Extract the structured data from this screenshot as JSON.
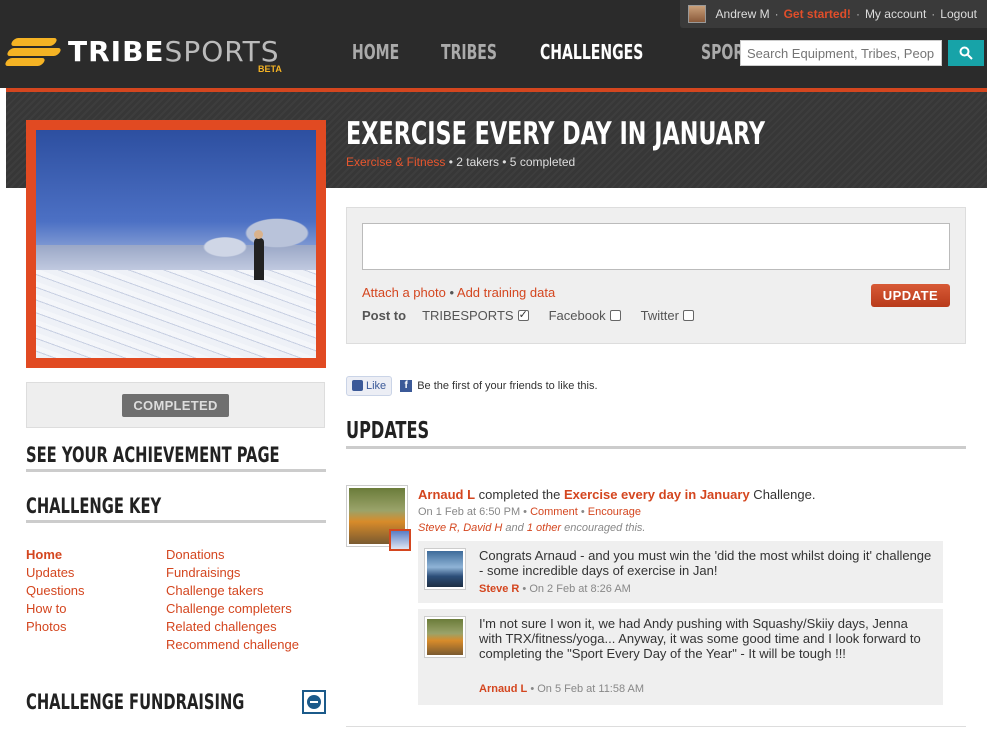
{
  "account": {
    "user": "Andrew M",
    "get_started": "Get started!",
    "my_account": "My account",
    "logout": "Logout",
    "separator": "·"
  },
  "brand": {
    "word_bold": "TRIBE",
    "word_light": "SPORTS",
    "beta": "BETA",
    "accent_color": "#f5b324"
  },
  "nav": {
    "items": [
      "HOME",
      "TRIBES",
      "CHALLENGES",
      "SPORTS"
    ],
    "active": "CHALLENGES"
  },
  "search": {
    "placeholder": "Search Equipment, Tribes, People",
    "icon": "search-icon"
  },
  "challenge": {
    "title": "EXERCISE EVERY DAY IN JANUARY",
    "category": "Exercise & Fitness",
    "takers": "• 2 takers • 5 completed",
    "status": "COMPLETED"
  },
  "sidebar": {
    "achievement_heading": "SEE YOUR ACHIEVEMENT PAGE",
    "key_heading": "CHALLENGE KEY",
    "key_col_1": [
      "Home",
      "Updates",
      "Questions",
      "How to",
      "Photos"
    ],
    "key_col_2": [
      "Donations",
      "Fundraisings",
      "Challenge takers",
      "Challenge completers",
      "Related challenges",
      "Recommend challenge"
    ],
    "fundraising_heading": "CHALLENGE FUNDRAISING"
  },
  "composer": {
    "attach_photo": "Attach a photo",
    "dot": " • ",
    "add_training": "Add training data",
    "post_to": "Post to",
    "targets": [
      "TRIBESPORTS",
      "Facebook",
      "Twitter"
    ],
    "update_button": "UPDATE"
  },
  "facebook": {
    "like": "Like",
    "text": "Be the first of your friends to like this."
  },
  "updates": {
    "heading": "UPDATES",
    "story": {
      "actor": "Arnaud L",
      "verb": " completed the ",
      "challenge": "Exercise every day in January",
      "suffix": " Challenge.",
      "time": "On 1 Feb at 6:50 PM • ",
      "comment": "Comment",
      "dot": " • ",
      "encourage": "Encourage",
      "encouragers": "Steve R, David H",
      "and": " and ",
      "others": "1 other",
      "enc_suffix": " encouraged this."
    },
    "comments": [
      {
        "text": "Congrats Arnaud - and you must win the 'did the most whilst doing it' challenge - some incredible days of exercise in Jan!",
        "author": "Steve R",
        "when": " • On 2 Feb at 8:26 AM"
      },
      {
        "text": "I'm not sure I won it, we had Andy pushing with Squashy/Skiiy days, Jenna with TRX/fitness/yoga... Anyway, it was some good time and I look forward to completing the \"Sport Every Day of the Year\" - It will be tough !!!",
        "author": "Arnaud L",
        "when": " • On 5 Feb at 11:58 AM"
      }
    ]
  },
  "colors": {
    "accent": "#d4461f",
    "header_bg": "#2b2b2b",
    "search_button": "#17a3a8"
  }
}
